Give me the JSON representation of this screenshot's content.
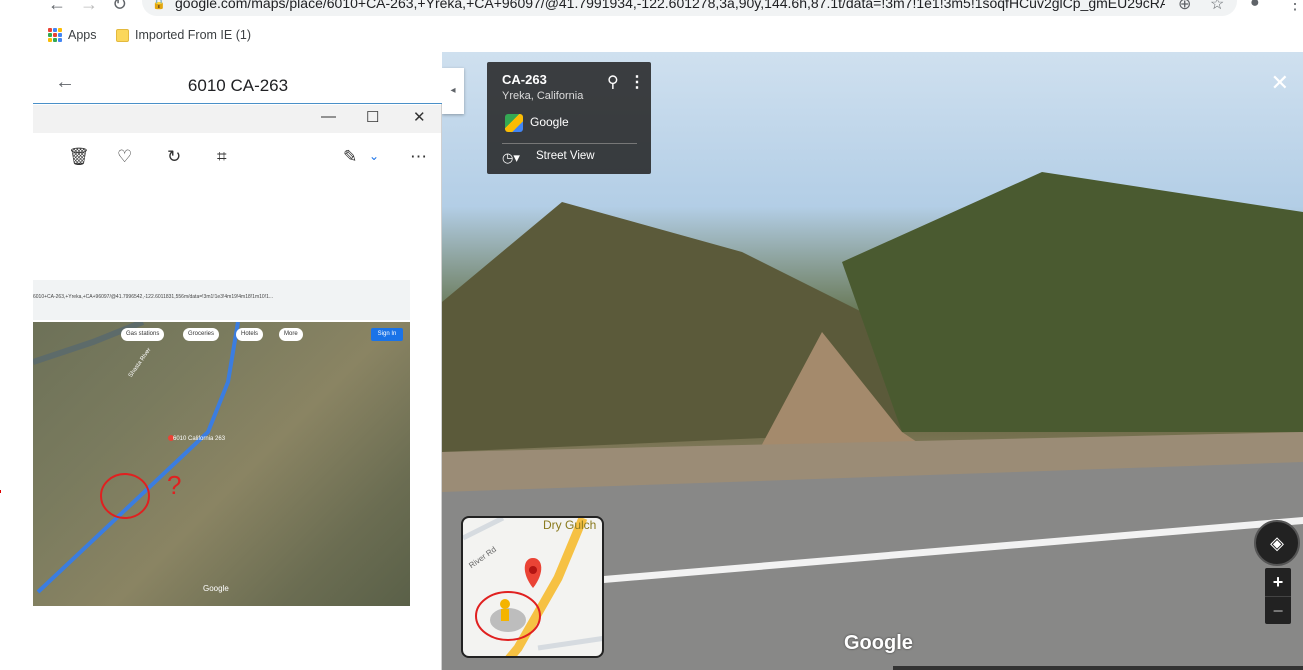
{
  "browser": {
    "url": "google.com/maps/place/6010+CA-263,+Yreka,+CA+96097/@41.7991934,-122.601278,3a,90y,144.6h,87.1t/data=!3m7!1e1!3m5!1soqfHCuv2glCp_gmEU29cRA!...",
    "bookmarks": [
      "Apps",
      "Imported From IE (1)"
    ]
  },
  "left_panel": {
    "title": "6010 CA-263",
    "screenshot": {
      "url": "6010+CA-263,+Yreka,+CA+96097/@41.7996542,-122.6011831,556m/data=!3m1!1e3!4m19!4m18!1m10!1...",
      "chips": [
        "Gas stations",
        "Groceries",
        "Hotels",
        "More"
      ],
      "sign_in": "Sign In",
      "place_label": "6010 California 263",
      "river_label": "Shasta River",
      "watermark": "Google",
      "question_mark": "?"
    }
  },
  "street_view": {
    "card_title": "CA-263",
    "card_subtitle": "Yreka, California",
    "provider": "Google",
    "mode": "Street View",
    "watermark": "Google",
    "minimap": {
      "label_dry": "Dry Gulch",
      "label_river": "River Rd"
    }
  },
  "colors": {
    "accent": "#4a90c8",
    "pin": "#ea4335",
    "annotation": "#e02020"
  }
}
